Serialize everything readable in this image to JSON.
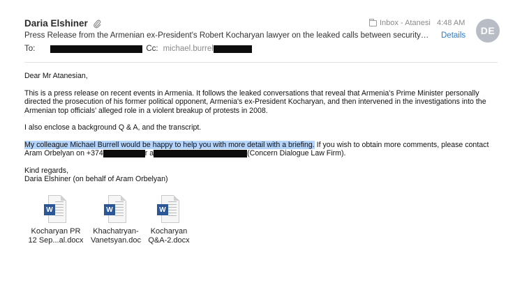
{
  "header": {
    "sender": "Daria Elshiner",
    "attachment_icon": "paperclip-icon",
    "folder_icon": "folder-icon",
    "folder": "Inbox - Atanesi",
    "time": "4:48 AM",
    "avatar_initials": "DE",
    "subject": "Press Release from the Armenian ex-President's Robert Kocharyan lawyer on the leaked calls between security chi...",
    "details_link": "Details",
    "to_label": "To:",
    "cc_label": "Cc:",
    "cc_value": "michael.burrel"
  },
  "body": {
    "greeting": "Dear Mr Atanesian,",
    "para1": "This is a press release on recent events in Armenia. It follows the leaked conversations that reveal that Armenia's Prime Minister personally directed the prosecution of his former political opponent, Armenia's ex-President Kocharyan, and then intervened in the investigations into the Armenian top officials' alleged role in a violent breakup of protests in 2008.",
    "para2": "I also enclose a background Q & A, and the transcript.",
    "para3_highlighted": "My colleague Michael Burrell would be happy to help you with more detail with a briefing.",
    "para3_rest": " If you wish to obtain more comments, please contact",
    "para3_line2_start": "Aram Orbelyan on +374",
    "para3_line2_mid": "r a",
    "para3_line2_end": "(Concern Dialogue Law Firm).",
    "signoff": "Kind regards,",
    "signature": "Daria Elshiner (on behalf of Aram Orbelyan)"
  },
  "attachments": [
    {
      "line1": "Kocharyan PR",
      "line2": "12 Sep...al.docx"
    },
    {
      "line1": "Khachatryan-",
      "line2": "Vanetsyan.doc"
    },
    {
      "line1": "Kocharyan",
      "line2": "Q&A-2.docx"
    }
  ],
  "colors": {
    "link": "#2a7ad6",
    "highlight": "#b3d4fc",
    "avatar": "#b8bcc4",
    "word_icon": "#2b5797"
  }
}
